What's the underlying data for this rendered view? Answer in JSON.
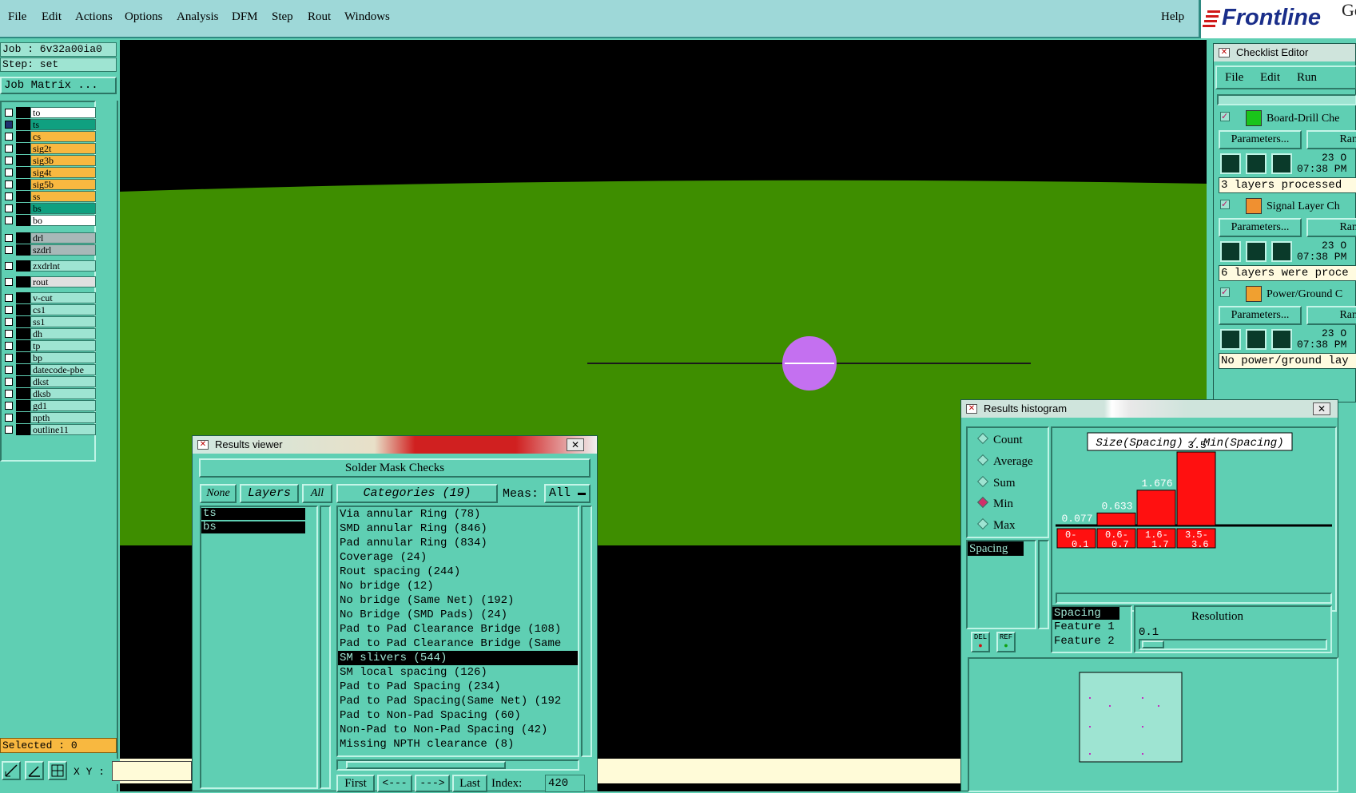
{
  "menubar": {
    "items": [
      "File",
      "Edit",
      "Actions",
      "Options",
      "Analysis",
      "DFM",
      "Step",
      "Rout",
      "Windows"
    ],
    "help": "Help",
    "brand": "Frontline",
    "brand_suffix": "Ge"
  },
  "left": {
    "job": "Job : 6v32a00ia0",
    "step": "Step: set",
    "job_matrix": "Job Matrix ...",
    "layers": [
      {
        "name": "to",
        "color": "#ffffff",
        "checked": false
      },
      {
        "name": "ts",
        "color": "#10a080",
        "checked": true
      },
      {
        "name": "cs",
        "color": "#f8b840",
        "checked": false
      },
      {
        "name": "sig2t",
        "color": "#f8b840",
        "checked": false
      },
      {
        "name": "sig3b",
        "color": "#f8b840",
        "checked": false
      },
      {
        "name": "sig4t",
        "color": "#f8b840",
        "checked": false
      },
      {
        "name": "sig5b",
        "color": "#f8b840",
        "checked": false
      },
      {
        "name": "ss",
        "color": "#f8b840",
        "checked": false
      },
      {
        "name": "bs",
        "color": "#10a080",
        "checked": false
      },
      {
        "name": "bo",
        "color": "#ffffff",
        "checked": false
      },
      {
        "name": "drl",
        "color": "#a8b8b8",
        "checked": false
      },
      {
        "name": "szdrl",
        "color": "#a8b8b8",
        "checked": false
      },
      {
        "name": "zxdrlnt",
        "color": "#9ee4d2",
        "checked": false
      },
      {
        "name": "rout",
        "color": "#e0e0e0",
        "checked": false
      },
      {
        "name": "v-cut",
        "color": "#9ee4d2",
        "checked": false
      },
      {
        "name": "cs1",
        "color": "#9ee4d2",
        "checked": false
      },
      {
        "name": "ss1",
        "color": "#9ee4d2",
        "checked": false
      },
      {
        "name": "dh",
        "color": "#9ee4d2",
        "checked": false
      },
      {
        "name": "tp",
        "color": "#9ee4d2",
        "checked": false
      },
      {
        "name": "bp",
        "color": "#9ee4d2",
        "checked": false
      },
      {
        "name": "datecode-pbe",
        "color": "#9ee4d2",
        "checked": false
      },
      {
        "name": "dkst",
        "color": "#9ee4d2",
        "checked": false
      },
      {
        "name": "dksb",
        "color": "#9ee4d2",
        "checked": false
      },
      {
        "name": "gd1",
        "color": "#9ee4d2",
        "checked": false
      },
      {
        "name": "npth",
        "color": "#9ee4d2",
        "checked": false
      },
      {
        "name": "outline11",
        "color": "#9ee4d2",
        "checked": false
      }
    ],
    "selected": "Selected : 0",
    "xy_label": "X Y :"
  },
  "results_viewer": {
    "title": "Results viewer",
    "header": "Solder Mask Checks",
    "none": "None",
    "layers": "Layers",
    "all": "All",
    "categories_label": "Categories (19)",
    "meas_label": "Meas:",
    "meas_value": "All",
    "layer_items": [
      "ts",
      "bs"
    ],
    "categories": [
      "Via annular Ring (78)",
      "SMD annular Ring (846)",
      "Pad annular Ring (834)",
      "Coverage (24)",
      "Rout spacing (244)",
      "No bridge (12)",
      "No bridge (Same Net) (192)",
      "No Bridge (SMD Pads) (24)",
      "Pad to Pad Clearance Bridge (108)",
      "Pad to Pad Clearance Bridge (Same",
      "SM slivers (544)",
      "SM local spacing (126)",
      "Pad to Pad Spacing (234)",
      "Pad to Pad Spacing(Same Net) (192",
      "Pad to Non-Pad Spacing (60)",
      "Non-Pad to Non-Pad Spacing (42)",
      "Missing NPTH clearance (8)"
    ],
    "selected_index": 10,
    "nav": {
      "first": "First",
      "prev": "<---",
      "next": "--->",
      "last": "Last",
      "index_label": "Index:",
      "index_value": "420"
    }
  },
  "checklist_editor": {
    "title": "Checklist Editor",
    "menu": [
      "File",
      "Edit",
      "Run"
    ],
    "checks": [
      {
        "name": "Board-Drill Che",
        "params": "Parameters...",
        "range": "Ran",
        "date": "23 O",
        "time": "07:38 PM",
        "note": "3 layers processed"
      },
      {
        "name": "Signal Layer Ch",
        "params": "Parameters...",
        "range": "Ran",
        "date": "23 O",
        "time": "07:38 PM",
        "note": "6 layers were proce"
      },
      {
        "name": "Power/Ground C",
        "params": "Parameters...",
        "range": "Ran",
        "date": "23 O",
        "time": "07:38 PM",
        "note": "No power/ground lay"
      }
    ]
  },
  "histogram": {
    "title": "Results histogram",
    "modes": [
      "Count",
      "Average",
      "Sum",
      "Min",
      "Max"
    ],
    "active_mode": "Min",
    "list_item": "Spacing",
    "del": "DEL",
    "ref": "REF",
    "fields": [
      "Spacing",
      "Feature 1",
      "Feature 2"
    ],
    "resolution_label": "Resolution",
    "resolution_value": "0.1",
    "colors": {
      "bar": "#ff1010"
    }
  },
  "chart_data": {
    "type": "bar",
    "title": "Size(Spacing) / Min(Spacing)",
    "categories": [
      "0-0.1",
      "0.6-0.7",
      "1.6-1.7",
      "3.5-3.6"
    ],
    "values": [
      0.077,
      0.633,
      1.676,
      3.5
    ],
    "value_labels": [
      "0.077",
      "0.633",
      "1.676",
      "3.5"
    ],
    "bar_heights_rel": [
      0,
      0.17,
      0.48,
      1.0
    ],
    "ylim": [
      0,
      3.5
    ]
  }
}
